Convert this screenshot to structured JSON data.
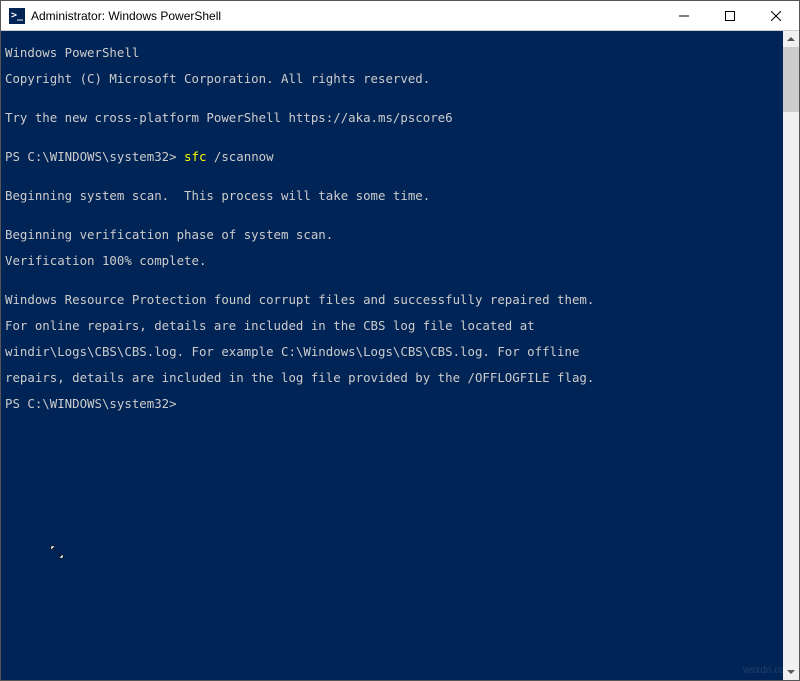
{
  "titlebar": {
    "icon_glyph": ">_",
    "title": "Administrator: Windows PowerShell"
  },
  "terminal": {
    "lines": {
      "banner1": "Windows PowerShell",
      "banner2": "Copyright (C) Microsoft Corporation. All rights reserved.",
      "blank1": "",
      "try": "Try the new cross-platform PowerShell https://aka.ms/pscore6",
      "blank2": "",
      "prompt1_prefix": "PS C:\\WINDOWS\\system32> ",
      "prompt1_cmd": "sfc ",
      "prompt1_arg": "/scannow",
      "blank3": "",
      "scan1": "Beginning system scan.  This process will take some time.",
      "blank4": "",
      "ver1": "Beginning verification phase of system scan.",
      "ver2": "Verification 100% complete.",
      "blank5": "",
      "res1": "Windows Resource Protection found corrupt files and successfully repaired them.",
      "res2": "For online repairs, details are included in the CBS log file located at",
      "res3": "windir\\Logs\\CBS\\CBS.log. For example C:\\Windows\\Logs\\CBS\\CBS.log. For offline",
      "res4": "repairs, details are included in the log file provided by the /OFFLOGFILE flag.",
      "prompt2": "PS C:\\WINDOWS\\system32>"
    }
  },
  "watermark": "wsxdn.com"
}
